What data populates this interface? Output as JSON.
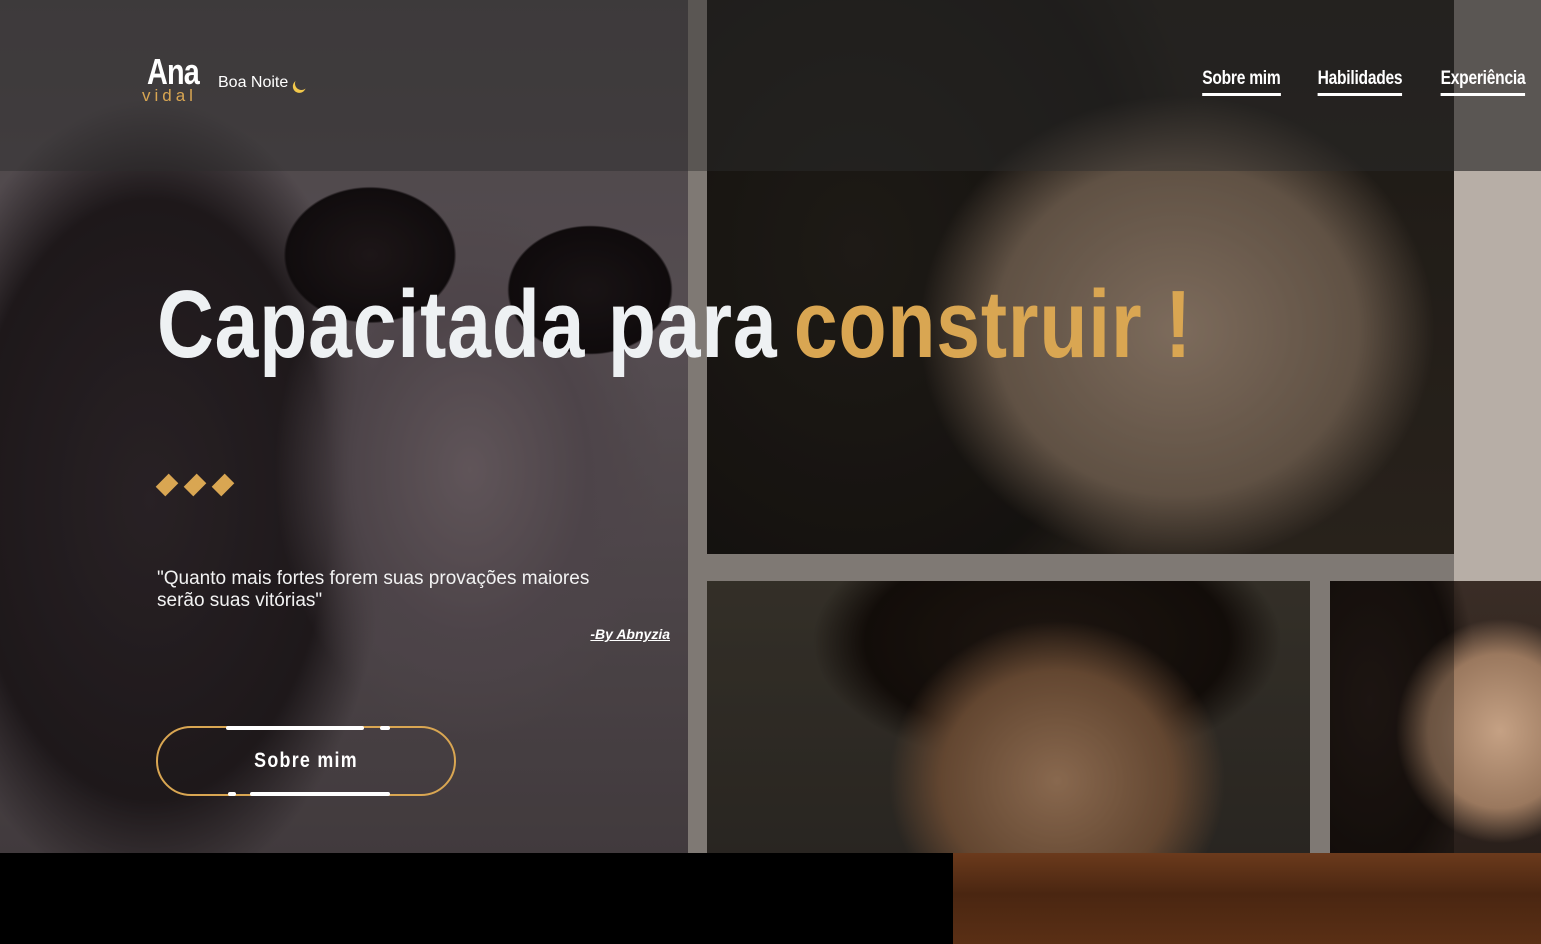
{
  "header": {
    "logo_main": "Ana",
    "logo_sub": "vidal",
    "greeting": "Boa Noite",
    "greeting_icon": "moon-icon"
  },
  "nav": {
    "items": [
      {
        "label": "Sobre mim"
      },
      {
        "label": "Habilidades"
      },
      {
        "label": "Experiência"
      }
    ]
  },
  "hero": {
    "headline_white": "Capacitada para",
    "headline_accent": "construir !",
    "decoration_icon": "diamond-icon",
    "quote": "\"Quanto mais fortes forem suas provações maiores serão suas vitórias\"",
    "quote_author": "-By Abnyzia",
    "cta_label": "Sobre mim"
  },
  "colors": {
    "accent": "#d9a652",
    "headline_white": "#eef1f3",
    "header_bg": "rgba(33,33,33,0.62)"
  }
}
